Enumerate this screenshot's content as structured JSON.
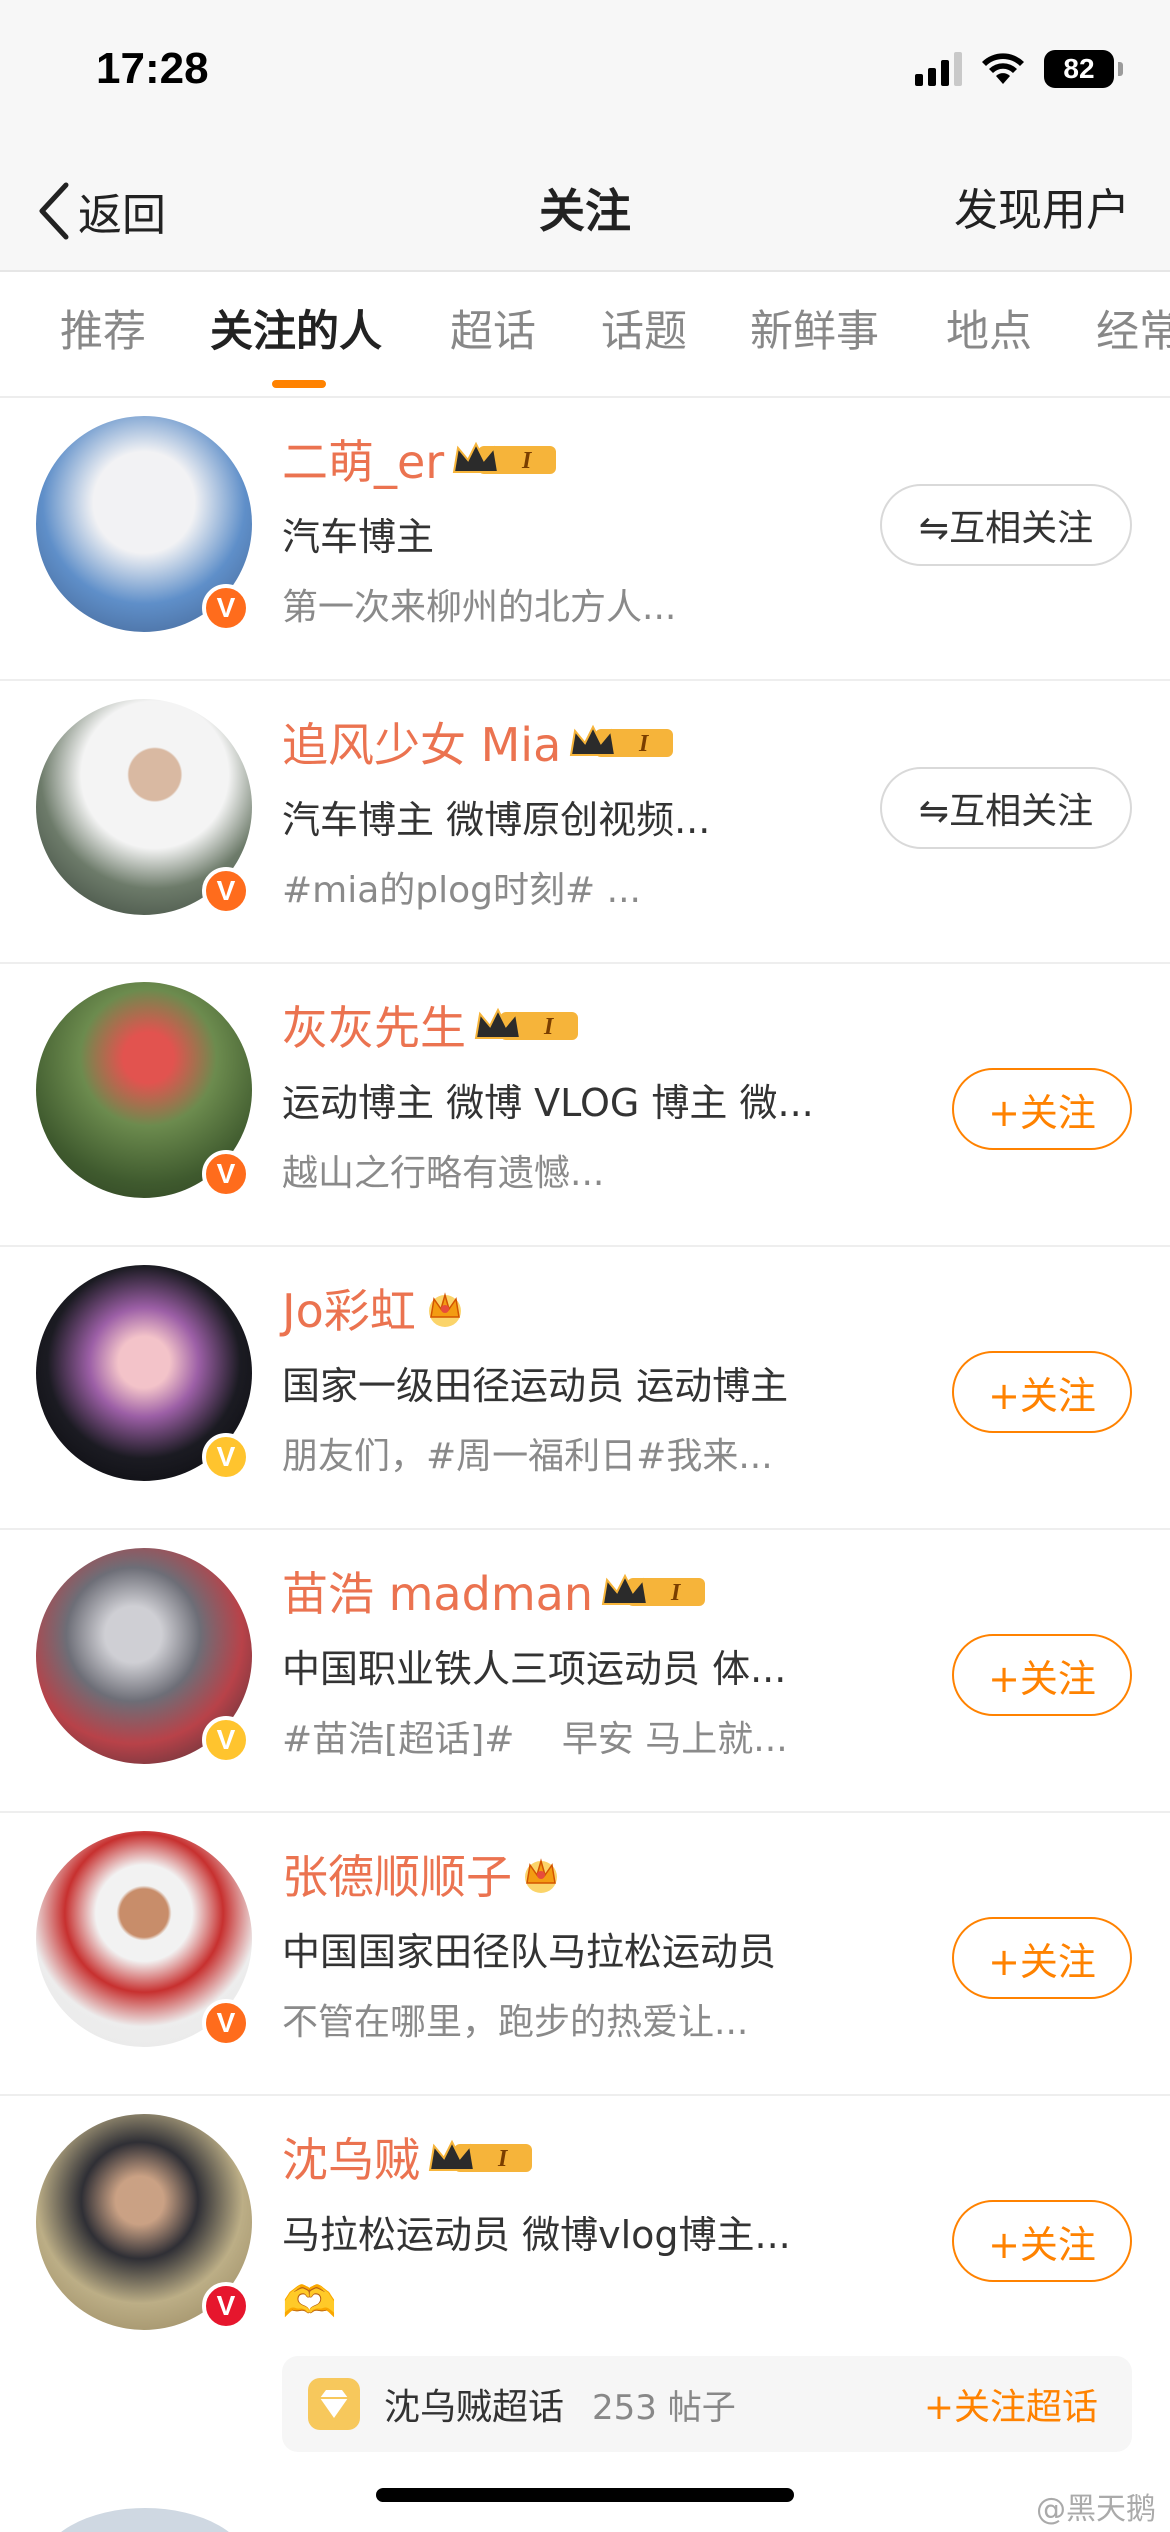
{
  "status_bar": {
    "time": "17:28",
    "battery": "82"
  },
  "nav": {
    "back_label": "返回",
    "title": "关注",
    "right_label": "发现用户"
  },
  "tabs": [
    {
      "label": "推荐"
    },
    {
      "label": "关注的人"
    },
    {
      "label": "超话"
    },
    {
      "label": "话题"
    },
    {
      "label": "新鲜事"
    },
    {
      "label": "地点"
    },
    {
      "label": "经常"
    }
  ],
  "colors": {
    "accent": "#ff8200",
    "name": "#eb7350",
    "verified_orange": "#ff6c1c",
    "verified_yellow": "#ffc42e",
    "verified_red": "#e6162d"
  },
  "buttons": {
    "mutual_label": "⇋互相关注",
    "follow_label": "+关注"
  },
  "users": [
    {
      "name": "二萌_er",
      "bio": "汽车博主",
      "desc": "第一次来柳州的北方人...",
      "relation": "mutual",
      "vip_level": "I"
    },
    {
      "name": "追风少女 Mia",
      "bio": "汽车博主 微博原创视频...",
      "desc": "#mia的plog时刻# ...",
      "relation": "mutual",
      "vip_level": "I"
    },
    {
      "name": "灰灰先生",
      "bio": "运动博主 微博 VLOG 博主 微...",
      "desc": "越山之行略有遗憾...",
      "relation": "follow",
      "vip_level": "I"
    },
    {
      "name": "Jo彩虹",
      "bio": "国家一级田径运动员 运动博主",
      "desc": "朋友们，#周一福利日#我来...",
      "relation": "follow",
      "vip_level": ""
    },
    {
      "name": "苗浩 madman",
      "bio": "中国职业铁人三项运动员 体...",
      "desc": "#苗浩[超话]#　 早安 马上就...",
      "relation": "follow",
      "vip_level": "I"
    },
    {
      "name": "张德顺顺子",
      "bio": "中国国家田径队马拉松运动员",
      "desc": "不管在哪里，跑步的热爱让...",
      "relation": "follow",
      "vip_level": ""
    },
    {
      "name": "沈乌贼",
      "bio": "马拉松运动员 微博vlog博主...",
      "desc": "🫶",
      "relation": "follow",
      "vip_level": "I",
      "topic": {
        "name": "沈乌贼超话",
        "count": "253 帖子",
        "follow_label": "+关注超话"
      }
    }
  ],
  "watermark": "@黑天鹅"
}
